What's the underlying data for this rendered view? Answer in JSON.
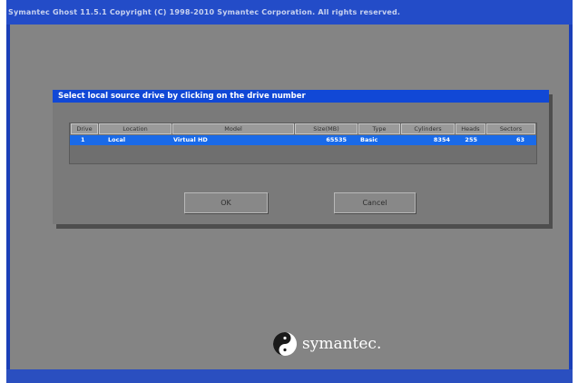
{
  "window": {
    "title": "Symantec Ghost 11.5.1   Copyright (C) 1998-2010 Symantec Corporation. All rights reserved."
  },
  "dialog": {
    "title": "Select local source drive by clicking on the drive number",
    "columns": [
      "Drive",
      "Location",
      "Model",
      "Size(MB)",
      "Type",
      "Cylinders",
      "Heads",
      "Sectors"
    ],
    "rows": [
      {
        "drive": "1",
        "location": "Local",
        "model": "Virtual HD",
        "size_mb": "65535",
        "type": "Basic",
        "cylinders": "8354",
        "heads": "255",
        "sectors": "63"
      }
    ],
    "ok_label": "OK",
    "cancel_label": "Cancel"
  },
  "branding": {
    "logo_text": "symantec."
  },
  "colors": {
    "desktop": "#848484",
    "title_bar": "#1148d6",
    "selection": "#1a6ae8",
    "screen_border": "#1a3fb8"
  }
}
